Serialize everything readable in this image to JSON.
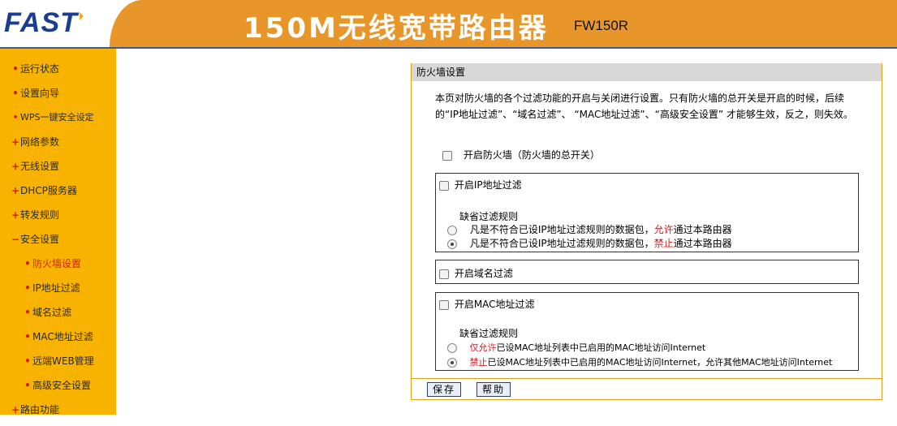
{
  "header": {
    "logo": "FAST",
    "title": "150M无线宽带路由器",
    "model": "FW150R"
  },
  "sidebar": {
    "items": [
      {
        "label": "运行状态",
        "bullet": "•"
      },
      {
        "label": "设置向导",
        "bullet": "•"
      },
      {
        "label": "WPS一键安全设定",
        "bullet": "•"
      },
      {
        "label": "网络参数",
        "bullet": "+"
      },
      {
        "label": "无线设置",
        "bullet": "+"
      },
      {
        "label": "DHCP服务器",
        "bullet": "+"
      },
      {
        "label": "转发规则",
        "bullet": "+"
      },
      {
        "label": "安全设置",
        "bullet": "−"
      },
      {
        "label": "防火墙设置",
        "bullet": "•"
      },
      {
        "label": "IP地址过滤",
        "bullet": "•"
      },
      {
        "label": "域名过滤",
        "bullet": "•"
      },
      {
        "label": "MAC地址过滤",
        "bullet": "•"
      },
      {
        "label": "远端WEB管理",
        "bullet": "•"
      },
      {
        "label": "高级安全设置",
        "bullet": "•"
      },
      {
        "label": "路由功能",
        "bullet": "+"
      }
    ]
  },
  "panel": {
    "title": "防火墙设置",
    "description": "本页对防火墙的各个过滤功能的开启与关闭进行设置。只有防火墙的总开关是开启的时候，后续的“IP地址过滤”、“域名过滤”、 “MAC地址过滤”、“高级安全设置” 才能够生效，反之，则失效。",
    "master_switch": "开启防火墙（防火墙的总开关）",
    "ip_filter": {
      "label": "开启IP地址过滤",
      "default_rule_label": "缺省过滤规则",
      "opt1_prefix": "凡是不符合已设IP地址过滤规则的数据包，",
      "opt1_red": "允许",
      "opt1_suffix": "通过本路由器",
      "opt2_prefix": "凡是不符合已设IP地址过滤规则的数据包，",
      "opt2_red": "禁止",
      "opt2_suffix": "通过本路由器"
    },
    "domain_filter": {
      "label": "开启域名过滤"
    },
    "mac_filter": {
      "label": "开启MAC地址过滤",
      "default_rule_label": "缺省过滤规则",
      "opt1_red": "仅允许",
      "opt1_suffix": "已设MAC地址列表中已启用的MAC地址访问Internet",
      "opt2_red": "禁止",
      "opt2_suffix": "已设MAC地址列表中已启用的MAC地址访问Internet，允许其他MAC地址访问Internet"
    },
    "buttons": {
      "save": "保存",
      "help": "帮助"
    }
  },
  "colors": {
    "accent_orange": "#e8962a",
    "sidebar_yellow": "#f8b300",
    "logo_blue": "#1a3d8f",
    "warning_red": "#d61e1e"
  }
}
